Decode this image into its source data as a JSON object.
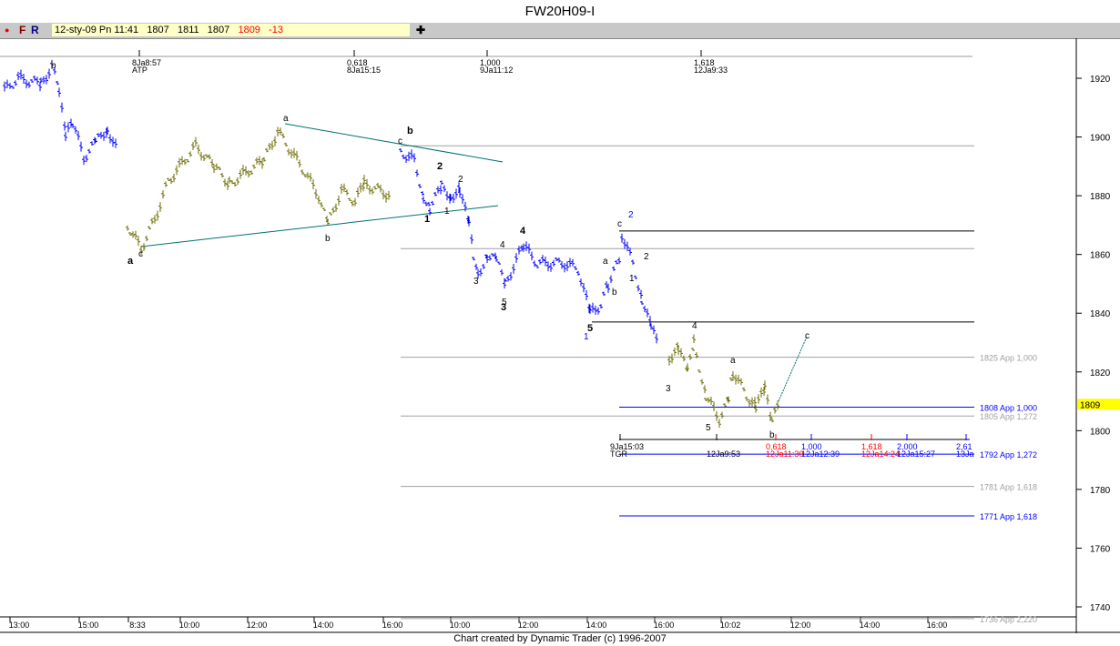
{
  "window": {
    "title": "FW20H09-I"
  },
  "toolbar": {
    "dot": "●",
    "f": "F",
    "r": "R",
    "date": "12-sty-09 Pn 11:41",
    "open": "1807",
    "high": "1811",
    "low": "1807",
    "last": "1809",
    "change": "-13",
    "plus": "✚"
  },
  "footer": "Chart created by Dynamic Trader  (c) 1996-2007",
  "colors": {
    "up": "#0000ff",
    "olive": "#6b6b00",
    "gray": "#a0a0a0",
    "red": "#ff0000",
    "teal": "#007070",
    "tag": "#ffff00"
  },
  "chart_data": {
    "type": "bar",
    "title": "FW20H09-I",
    "ylim": [
      1740,
      1920
    ],
    "yticks": [
      "1740",
      "1760",
      "1780",
      "1800",
      "1820",
      "1840",
      "1860",
      "1880",
      "1900",
      "1920"
    ],
    "xticks": [
      "13:00",
      "15:00",
      "8:33",
      "10:00",
      "12:00",
      "14:00",
      "16:00",
      "10:00",
      "12:00",
      "14:00",
      "16:00",
      "10:02",
      "12:00",
      "14:00",
      "16:00"
    ],
    "last_price": "1809",
    "segments": [
      {
        "color": "up",
        "prices": [
          1916,
          1920,
          1918,
          1924,
          1916,
          1900,
          1905,
          1893,
          1898,
          1903,
          1896
        ]
      },
      {
        "color": "olive",
        "prices": [
          1870,
          1862,
          1872,
          1885,
          1897,
          1890,
          1884,
          1888,
          1892,
          1902,
          1895,
          1888,
          1880,
          1870,
          1882,
          1878,
          1884,
          1880
        ]
      },
      {
        "color": "up",
        "prices": [
          1895,
          1892,
          1880,
          1876,
          1883,
          1880,
          1882,
          1870,
          1860,
          1853,
          1860,
          1858,
          1850,
          1860,
          1863,
          1857,
          1857,
          1855,
          1840,
          1843,
          1850,
          1858,
          1867,
          1857,
          1845,
          1835,
          1830
        ]
      },
      {
        "color": "olive",
        "prices": [
          1825,
          1828,
          1820,
          1830,
          1812,
          1804,
          1810,
          1820,
          1812,
          1808,
          1814,
          1803,
          1809
        ]
      }
    ],
    "levels": [
      {
        "price": 1897,
        "color": "gray",
        "label": ""
      },
      {
        "price": 1868,
        "color": "black",
        "label": ""
      },
      {
        "price": 1862,
        "color": "gray",
        "label": ""
      },
      {
        "price": 1837,
        "color": "black",
        "label": ""
      },
      {
        "price": 1825,
        "color": "gray",
        "label": "1825 App 1,000"
      },
      {
        "price": 1808,
        "color": "up",
        "label": "1808 App 1,000"
      },
      {
        "price": 1805,
        "color": "gray",
        "label": "1805 App 1,272"
      },
      {
        "price": 1792,
        "color": "up",
        "label": "1792 App 1,272"
      },
      {
        "price": 1781,
        "color": "gray",
        "label": "1781 App 1,618"
      },
      {
        "price": 1771,
        "color": "up",
        "label": "1771 App 1,618"
      },
      {
        "price": 1736,
        "color": "gray",
        "label": "1736 App 2,220"
      }
    ],
    "top_time_markers": [
      [
        "8Ja8:57",
        "ATP"
      ],
      [
        "0,618",
        "8Ja15:15"
      ],
      [
        "1,000",
        "9Ja11:12"
      ],
      [
        "1,618",
        "12Ja9:33"
      ]
    ],
    "bottom_time_markers": [
      [
        "9Ja15:03",
        "TGR",
        "black"
      ],
      [
        "",
        "12Ja9:53",
        "black"
      ],
      [
        "0,618",
        "12Ja11:30",
        "red"
      ],
      [
        "1,000",
        "12Ja12:39",
        "up"
      ],
      [
        "1,618",
        "12Ja14:24",
        "red"
      ],
      [
        "2,000",
        "12Ja15:27",
        "up"
      ],
      [
        "2,61",
        "13Ja",
        "up"
      ]
    ],
    "wave_labels": [
      "b",
      "a",
      "c",
      "a",
      "b",
      "c",
      "b",
      "1",
      "2",
      "2",
      "1",
      "3",
      "4",
      "4",
      "5",
      "3",
      "5",
      "1",
      "a",
      "b",
      "c",
      "2",
      "2",
      "1",
      "4",
      "3",
      "a",
      "5",
      "b",
      "c"
    ]
  }
}
